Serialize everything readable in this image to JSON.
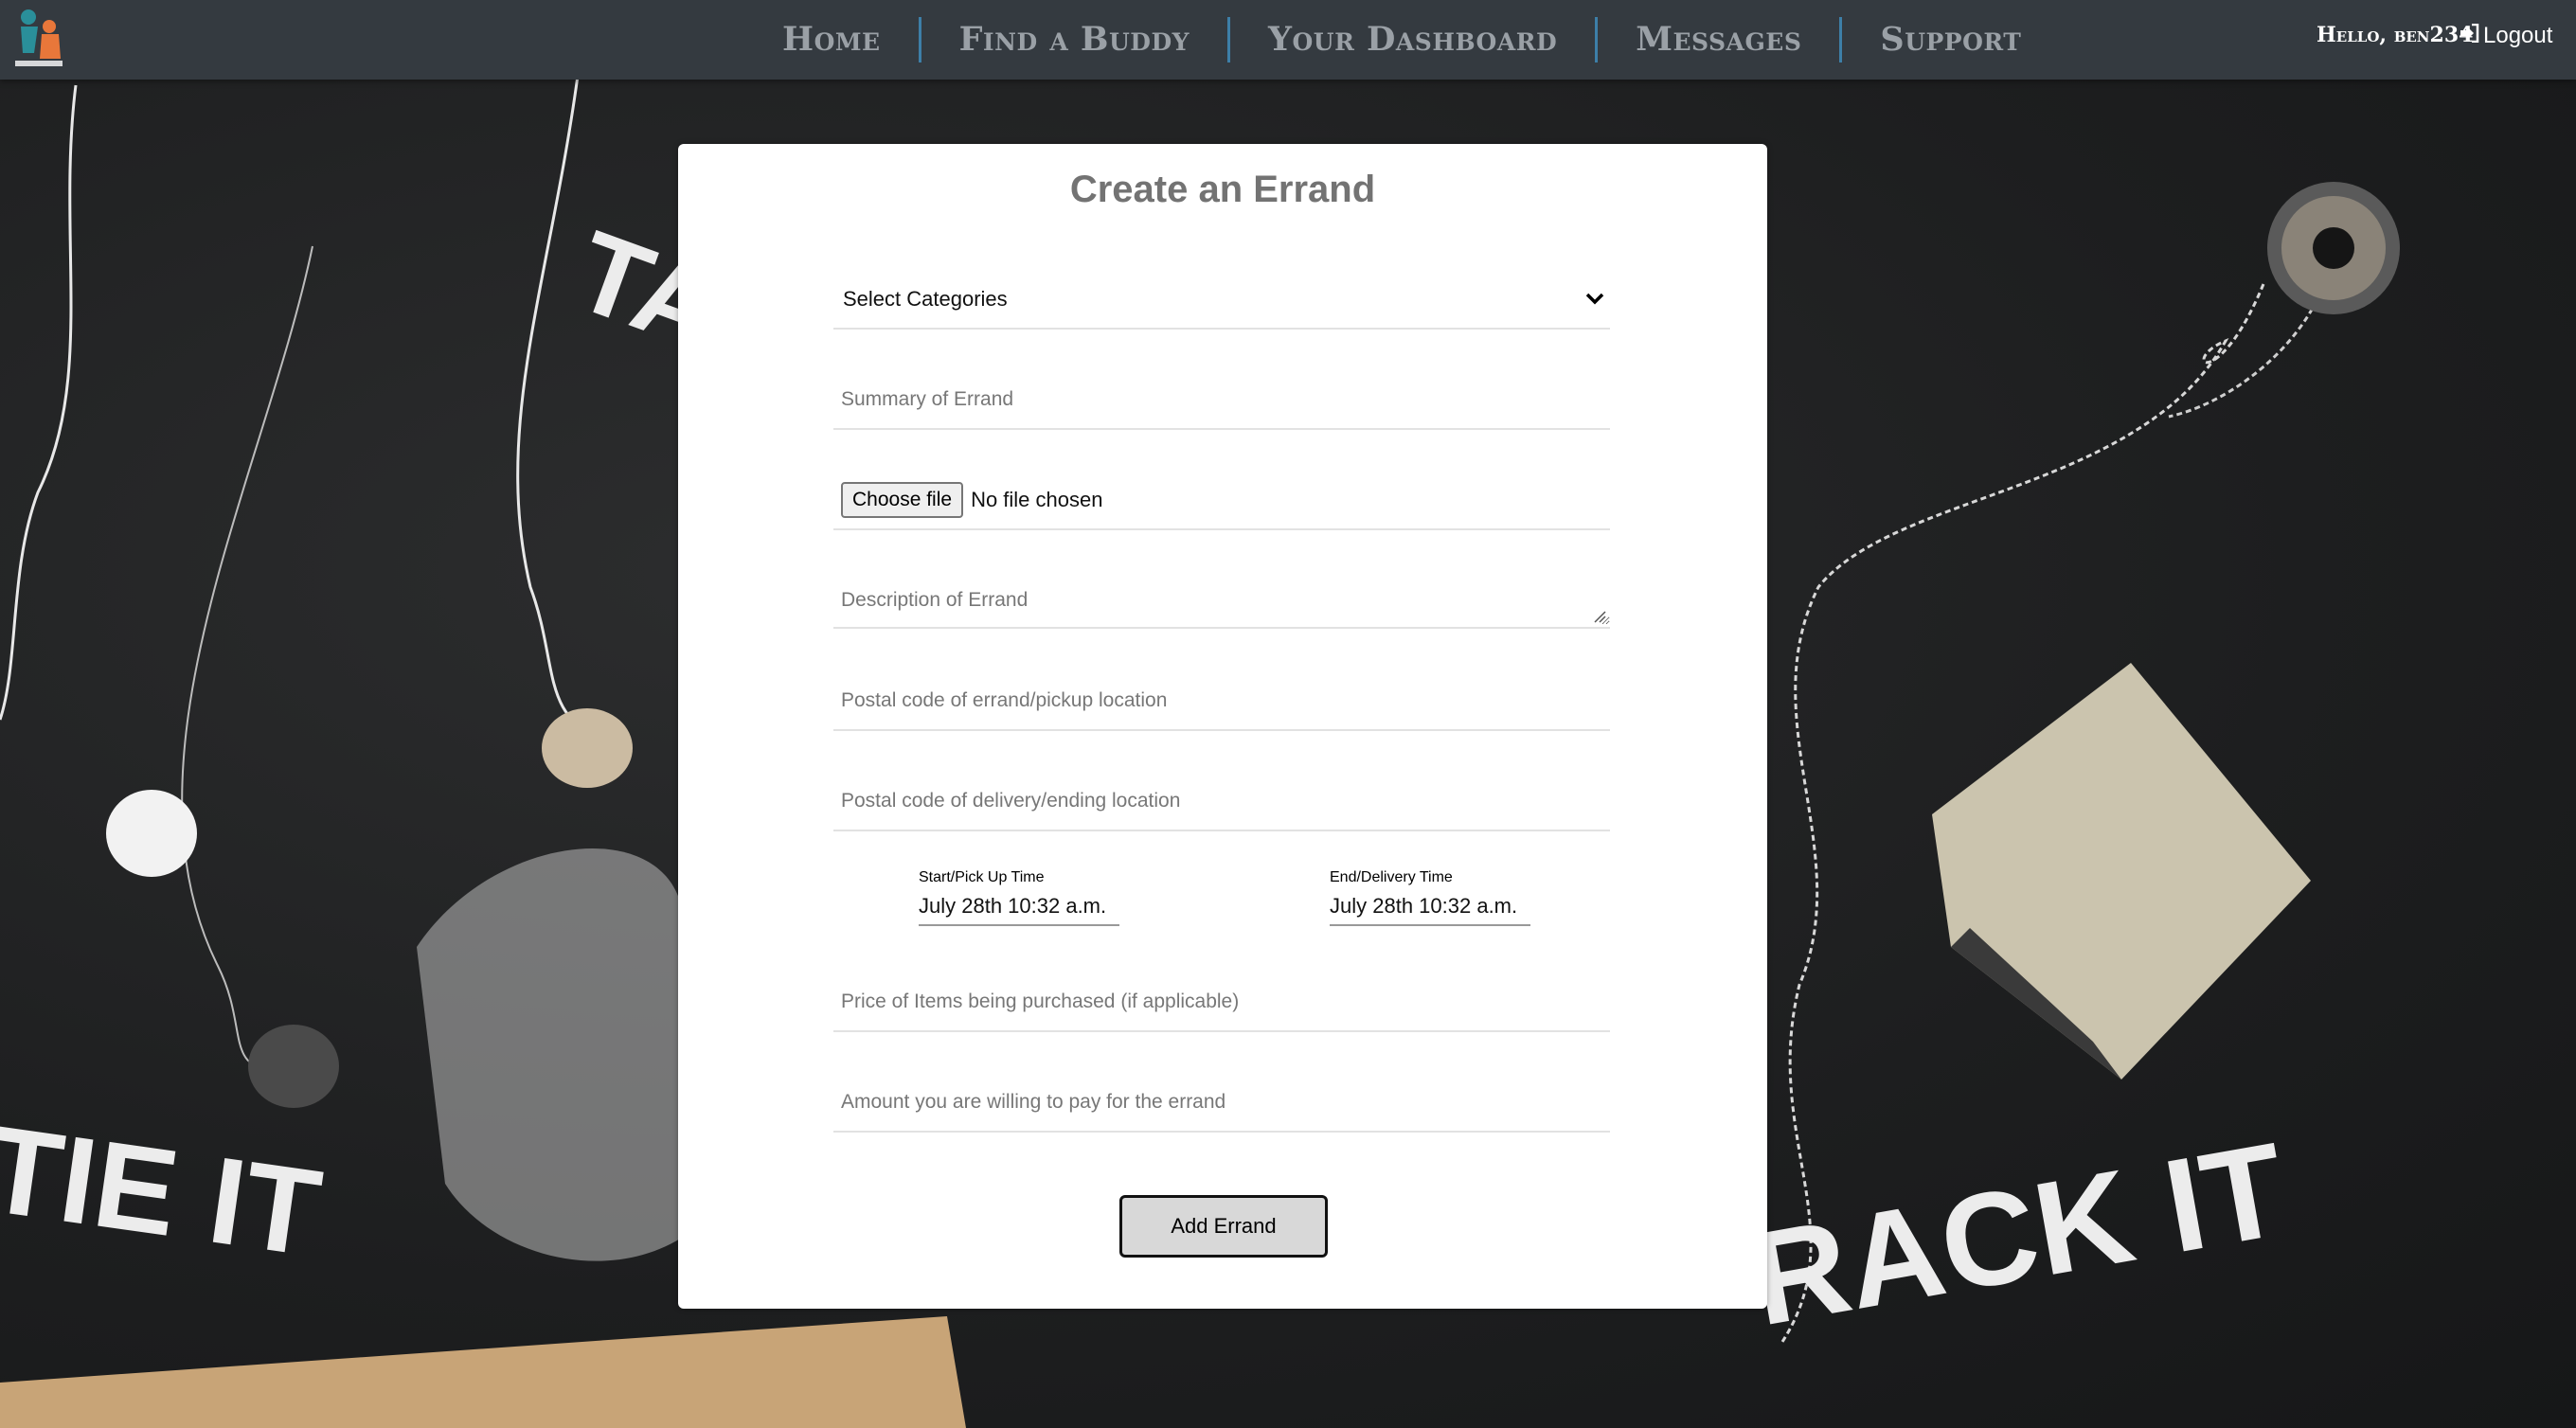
{
  "brand": {
    "logo_icon": "carry-buddy-logo"
  },
  "nav": {
    "links": [
      "Home",
      "Find a Buddy",
      "Your Dashboard",
      "Messages",
      "Support"
    ],
    "greeting": "Hello, ben234",
    "logout_label": "Logout",
    "logout_icon": "sign-out-icon",
    "accent_color": "#3d7fa8",
    "bar_color": "#343a40"
  },
  "background": {
    "words": [
      "TAG",
      "TIE IT",
      "RACK IT"
    ]
  },
  "form": {
    "title": "Create an Errand",
    "category": {
      "selected": "Select Categories",
      "icon": "chevron-down-icon"
    },
    "summary_placeholder": "Summary of Errand",
    "file": {
      "button_label": "Choose file",
      "status": "No file chosen"
    },
    "description_placeholder": "Description of Errand",
    "pickup_placeholder": "Postal code of errand/pickup location",
    "delivery_placeholder": "Postal code of delivery/ending location",
    "start_time": {
      "label": "Start/Pick Up Time",
      "value": "July 28th 10:32 a.m."
    },
    "end_time": {
      "label": "End/Delivery Time",
      "value": "July 28th 10:32 a.m."
    },
    "price_placeholder": "Price of Items being purchased (if applicable)",
    "amount_placeholder": "Amount you are willing to pay for the errand",
    "submit_label": "Add Errand"
  }
}
